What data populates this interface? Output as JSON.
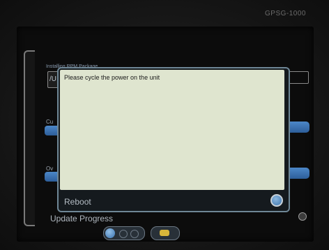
{
  "device": {
    "model": "GPSG-1000"
  },
  "background": {
    "installing_label": "Installing RPM Package",
    "path_text": "/U",
    "cut_label": "Cu",
    "ov_label": "Ov"
  },
  "dialog": {
    "message": "Please cycle the power on the unit",
    "action_label": "Reboot"
  },
  "footer": {
    "progress_label": "Update Progress"
  },
  "colors": {
    "message_background": "#dfe5cf",
    "accent_blue": "#3f76ae",
    "dialog_border": "#6f8796"
  }
}
